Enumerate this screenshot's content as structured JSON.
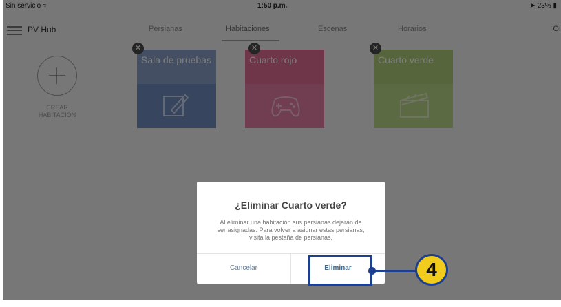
{
  "status_bar": {
    "carrier": "Sin servicio",
    "time": "1:50 p.m.",
    "battery": "23%"
  },
  "nav": {
    "app_title": "PV Hub",
    "tabs": [
      "Persianas",
      "Habitaciones",
      "Escenas",
      "Horarios"
    ],
    "active_tab": "Habitaciones",
    "right_text": "OI"
  },
  "create_room": {
    "line1": "CREAR",
    "line2": "HABITACIÓN"
  },
  "rooms": [
    {
      "name": "Sala de pruebas",
      "icon": "pencil-icon",
      "color_top": "#7e97c4",
      "color_bottom": "#6f8bbd"
    },
    {
      "name": "Cuarto rojo",
      "icon": "gamepad-icon",
      "color_top": "#dd5d8a",
      "color_bottom": "#e27aa0"
    },
    {
      "name": "Cuarto verde",
      "icon": "clapperboard-icon",
      "color_top": "#a6c76c",
      "color_bottom": "#b7d486"
    }
  ],
  "dialog": {
    "title": "¿Eliminar Cuarto verde?",
    "body_line1": "Al eliminar una habitación sus persianas dejarán de",
    "body_line2": "ser asignadas. Para volver a asignar estas persianas,",
    "body_line3": "visita la pestaña de persianas.",
    "cancel_label": "Cancelar",
    "delete_label": "Eliminar"
  },
  "callout": {
    "step": "4",
    "color": "#1d3f8f",
    "badge_color": "#f2cc1c"
  }
}
